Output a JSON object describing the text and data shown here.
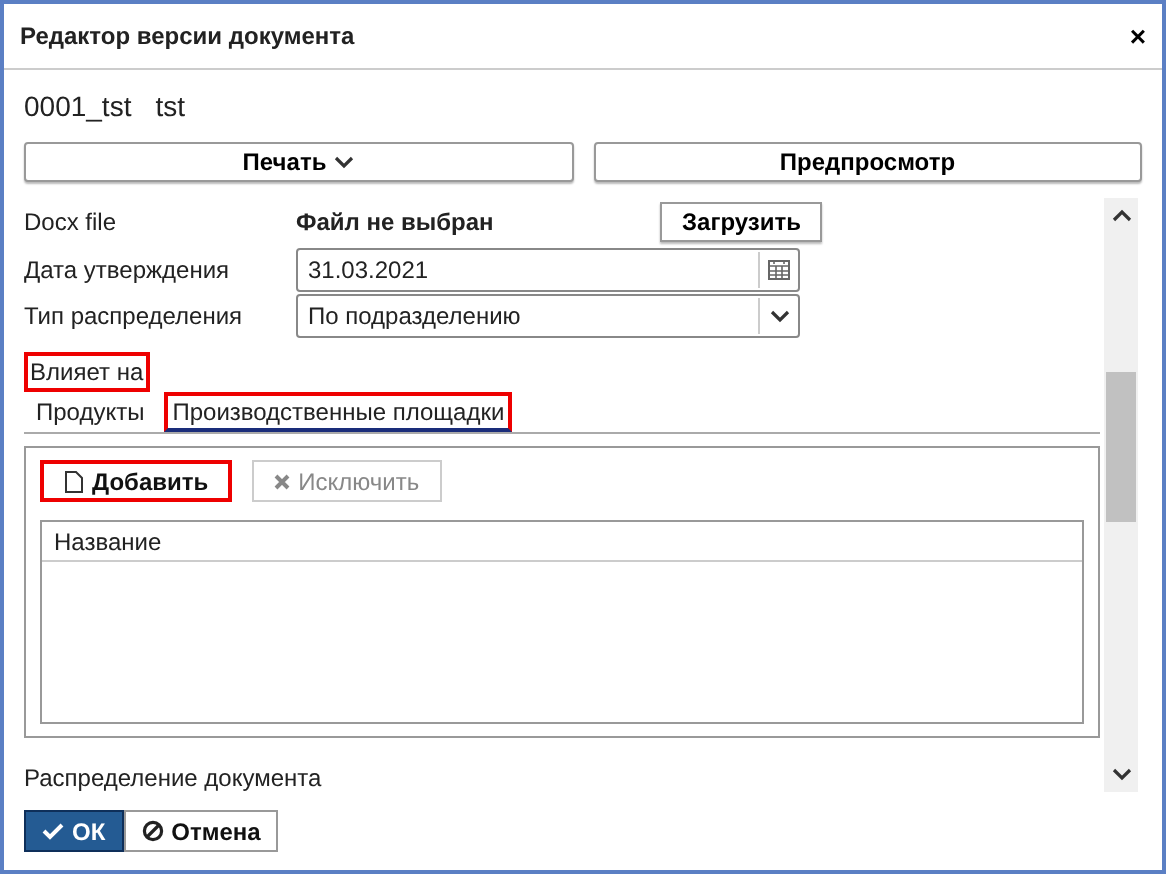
{
  "window": {
    "title": "Редактор версии документа",
    "close": "×"
  },
  "header": {
    "code": "0001_tst",
    "name": "tst"
  },
  "top_buttons": [
    {
      "label": "Печать",
      "kind": "dropdown"
    },
    {
      "label": "Предпросмотр",
      "kind": "plain"
    }
  ],
  "form": [
    {
      "kind": "file",
      "label": "Docx file",
      "value": "Файл не выбран",
      "button": "Загрузить"
    },
    {
      "kind": "date",
      "label": "Дата утверждения",
      "value": "31.03.2021"
    },
    {
      "kind": "select",
      "label": "Тип распределения",
      "value": "По подразделению"
    }
  ],
  "affects": {
    "label": "Влияет на",
    "highlighted": true
  },
  "tabs": [
    {
      "label": "Продукты",
      "selected": false,
      "highlighted": false
    },
    {
      "label": "Производственные площадки",
      "selected": true,
      "highlighted": true
    }
  ],
  "toolbar": [
    {
      "label": "Добавить",
      "kind": "add",
      "disabled": false,
      "highlighted": true
    },
    {
      "label": "Исключить",
      "kind": "remove",
      "disabled": true,
      "highlighted": false
    }
  ],
  "table": {
    "columns": [
      "Название"
    ]
  },
  "next_section": "Распределение документа",
  "footer_buttons": [
    {
      "label": "ОК",
      "kind": "ok"
    },
    {
      "label": "Отмена",
      "kind": "cancel"
    }
  ]
}
